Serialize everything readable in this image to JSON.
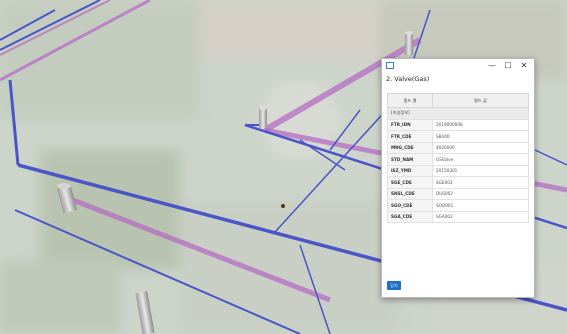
{
  "window": {
    "title": "2. Valve(Gas)",
    "controls": {
      "minimize": "—",
      "maximize": "☐",
      "close": "✕"
    }
  },
  "table": {
    "headers": [
      "필드 명",
      "필드 값"
    ],
    "section": "[속성정보]",
    "rows": [
      {
        "key": "FTR_IDN",
        "value": "2019000008"
      },
      {
        "key": "FTR_CDE",
        "value": "SB440"
      },
      {
        "key": "MNG_CDE",
        "value": "4020000"
      },
      {
        "key": "STD_NAM",
        "value": "GSValve"
      },
      {
        "key": "ISZ_YMD",
        "value": "20150301"
      },
      {
        "key": "SGE_CDE",
        "value": "SGE003"
      },
      {
        "key": "SNSL_CDE",
        "value": "DUS002"
      },
      {
        "key": "SGO_CDE",
        "value": "SOO001"
      },
      {
        "key": "SGA_CDE",
        "value": "SGA002"
      }
    ]
  },
  "footer": {
    "ok_label": "닫기"
  },
  "colors": {
    "pipe_blue": "#4a55c8",
    "pipe_magenta": "#b46cc4",
    "button": "#1f6fc5"
  }
}
